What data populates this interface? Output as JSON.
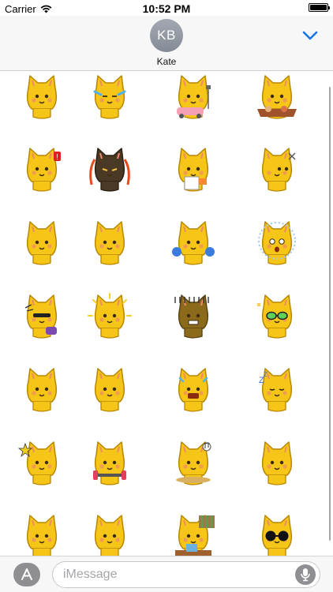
{
  "status_bar": {
    "carrier": "Carrier",
    "time": "10:52 PM",
    "battery_level": 1.0
  },
  "header": {
    "avatar_initials": "KB",
    "contact_name": "Kate",
    "collapse_icon": "chevron-down-icon",
    "accent_color": "#1a73e8"
  },
  "stickers": {
    "columns": 4,
    "rows": 7,
    "items": [
      {
        "name": "cat-sticker-crying-angry",
        "variant": "plain"
      },
      {
        "name": "cat-sticker-tears-of-joy",
        "variant": "tears"
      },
      {
        "name": "cat-sticker-riding-car",
        "variant": "car"
      },
      {
        "name": "cat-sticker-eating-feast",
        "variant": "feast"
      },
      {
        "name": "cat-sticker-surprised-alert",
        "variant": "alert"
      },
      {
        "name": "cat-sticker-burning-rage",
        "variant": "dark"
      },
      {
        "name": "cat-sticker-holding-sign",
        "variant": "sign"
      },
      {
        "name": "cat-sticker-side-glance",
        "variant": "side"
      },
      {
        "name": "cat-sticker-sleepy",
        "variant": "plain"
      },
      {
        "name": "cat-sticker-bored",
        "variant": "plain"
      },
      {
        "name": "cat-sticker-cheerleader",
        "variant": "pompom"
      },
      {
        "name": "cat-sticker-shocked",
        "variant": "shock"
      },
      {
        "name": "cat-sticker-dancing",
        "variant": "dance"
      },
      {
        "name": "cat-sticker-shining",
        "variant": "shine"
      },
      {
        "name": "cat-sticker-gloomy",
        "variant": "gloomy"
      },
      {
        "name": "cat-sticker-sunglasses",
        "variant": "glasses"
      },
      {
        "name": "cat-sticker-drinking",
        "variant": "plain"
      },
      {
        "name": "cat-sticker-wink",
        "variant": "plain"
      },
      {
        "name": "cat-sticker-panic",
        "variant": "panic"
      },
      {
        "name": "cat-sticker-sleeping",
        "variant": "zzz"
      },
      {
        "name": "cat-sticker-pointing",
        "variant": "star"
      },
      {
        "name": "cat-sticker-lifting",
        "variant": "dumbbell"
      },
      {
        "name": "cat-sticker-music-eating",
        "variant": "music"
      },
      {
        "name": "cat-sticker-tongue-out",
        "variant": "plain"
      },
      {
        "name": "cat-sticker-unimpressed",
        "variant": "plain"
      },
      {
        "name": "cat-sticker-teary",
        "variant": "plain"
      },
      {
        "name": "cat-sticker-studying",
        "variant": "study"
      },
      {
        "name": "cat-sticker-cool-shades",
        "variant": "bigglasses"
      }
    ]
  },
  "bottom_bar": {
    "app_store_icon": "app-store-icon",
    "message_placeholder": "iMessage",
    "mic_icon": "microphone-icon"
  }
}
